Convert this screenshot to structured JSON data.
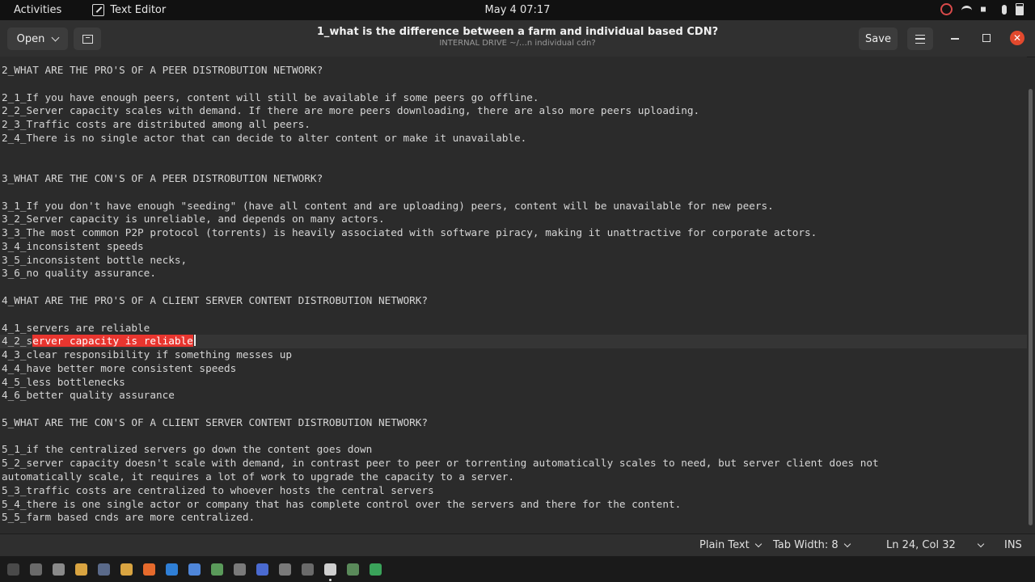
{
  "topbar": {
    "activities": "Activities",
    "app_name": "Text Editor",
    "clock": "May 4  07:17"
  },
  "header": {
    "open_label": "Open",
    "title": "1_what is the difference between a farm and individual based CDN?",
    "subtitle": "INTERNAL DRIVE ~/…n individual cdn?",
    "save_label": "Save"
  },
  "editor": {
    "lines": [
      "2_WHAT ARE THE PRO'S OF A PEER DISTROBUTION NETWORK?",
      "",
      "2_1_If you have enough peers, content will still be available if some peers go offline.",
      "2_2_Server capacity scales with demand. If there are more peers downloading, there are also more peers uploading.",
      "2_3_Traffic costs are distributed among all peers.",
      "2_4_There is no single actor that can decide to alter content or make it unavailable.",
      "",
      "",
      "3_WHAT ARE THE CON'S OF A PEER DISTROBUTION NETWORK?",
      "",
      "3_1_If you don't have enough \"seeding\" (have all content and are uploading) peers, content will be unavailable for new peers.",
      "3_2_Server capacity is unreliable, and depends on many actors.",
      "3_3_The most common P2P protocol (torrents) is heavily associated with software piracy, making it unattractive for corporate actors.",
      "3_4_inconsistent speeds",
      "3_5_inconsistent bottle necks,",
      "3_6_no quality assurance.",
      "",
      "4_WHAT ARE THE PRO'S OF A CLIENT SERVER CONTENT DISTROBUTION NETWORK?",
      "",
      "4_1_servers are reliable",
      "4_2_s",
      "4_3_clear responsibility if something messes up",
      "4_4_have better more consistent speeds",
      "4_5_less bottlenecks",
      "4_6_better quality assurance",
      "",
      "5_WHAT ARE THE CON'S OF A CLIENT SERVER CONTENT DISTROBUTION NETWORK?",
      "",
      "5_1_if the centralized servers go down the content goes down",
      "5_2_server capacity doesn't scale with demand, in contrast peer to peer or torrenting automatically scales to need, but server client does not",
      "automatically scale, it requires a lot of work to upgrade the capacity to a server.",
      "5_3_traffic costs are centralized to whoever hosts the central servers",
      "5_4_there is one single actor or company that has complete control over the servers and there for the content.",
      "5_5_farm based cnds are more centralized."
    ],
    "current_line_index": 20,
    "selected_text": "erver capacity is reliable"
  },
  "status": {
    "language": "Plain Text",
    "tab_width": "Tab Width: 8",
    "position": "Ln 24, Col 32",
    "mode": "INS"
  },
  "dock": {
    "icons": [
      "terminal-icon",
      "window-icon",
      "app-icon",
      "chrome-icon",
      "files-icon",
      "chrome-icon",
      "firefox-icon",
      "edge-icon",
      "doc-icon",
      "app-icon",
      "settings-icon",
      "app-icon",
      "app-icon",
      "files-icon",
      "text-editor-icon",
      "calculator-icon",
      "app-icon"
    ]
  }
}
